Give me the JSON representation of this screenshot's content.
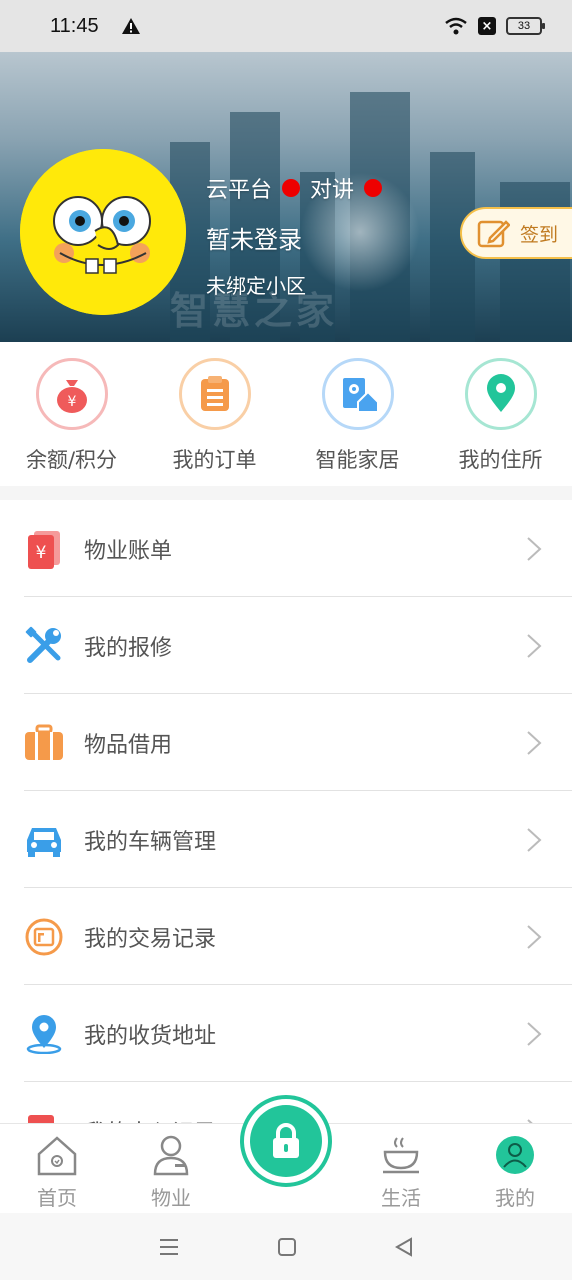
{
  "status_bar": {
    "time": "11:45",
    "battery": "33"
  },
  "header": {
    "platform_label": "云平台",
    "intercom_label": "对讲",
    "login_status": "暂未登录",
    "community_status": "未绑定小区",
    "watermark": "智慧之家",
    "signin_label": "签到"
  },
  "quick_actions": [
    {
      "label": "余额/积分",
      "icon": "money-bag-icon",
      "color": "#ef5b5b"
    },
    {
      "label": "我的订单",
      "icon": "clipboard-icon",
      "color": "#f59a4a"
    },
    {
      "label": "智能家居",
      "icon": "smart-home-icon",
      "color": "#4aa3ef"
    },
    {
      "label": "我的住所",
      "icon": "location-pin-icon",
      "color": "#22c59a"
    }
  ],
  "menu": [
    {
      "label": "物业账单",
      "icon": "bill-icon"
    },
    {
      "label": "我的报修",
      "icon": "repair-tools-icon"
    },
    {
      "label": "物品借用",
      "icon": "luggage-icon"
    },
    {
      "label": "我的车辆管理",
      "icon": "car-icon"
    },
    {
      "label": "我的交易记录",
      "icon": "transaction-icon"
    },
    {
      "label": "我的收货地址",
      "icon": "address-pin-icon"
    },
    {
      "label": "我的出入记录",
      "icon": "access-record-icon"
    }
  ],
  "tabs": [
    {
      "label": "首页",
      "icon": "home-icon"
    },
    {
      "label": "物业",
      "icon": "property-person-icon"
    },
    {
      "label": "生活",
      "icon": "coffee-cup-icon"
    },
    {
      "label": "我的",
      "icon": "profile-icon"
    }
  ],
  "colors": {
    "accent": "#22c59a",
    "red_dot": "#ee0000",
    "signin_border": "#f5c04a"
  }
}
